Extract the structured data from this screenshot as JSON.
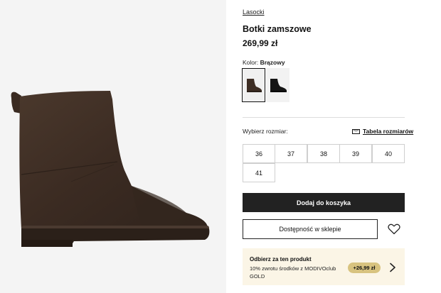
{
  "product": {
    "brand": "Lasocki",
    "name": "Botki zamszowe",
    "price": "269,99 zł"
  },
  "color": {
    "label": "Kolor:",
    "value": "Brązowy",
    "swatches": [
      {
        "name": "brown",
        "color": "#3a2a21",
        "selected": true
      },
      {
        "name": "black",
        "color": "#151515",
        "selected": false
      }
    ]
  },
  "sizes": {
    "label": "Wybierz rozmiar:",
    "table_link": "Tabela rozmiarów",
    "options": [
      "36",
      "37",
      "38",
      "39",
      "40",
      "41"
    ]
  },
  "actions": {
    "add_to_cart": "Dodaj do koszyka",
    "store_availability": "Dostępność w sklepie",
    "wishlist_icon": "heart-icon"
  },
  "promo": {
    "title": "Odbierz za ten produkt",
    "description": "10% zwrotu środków z MODIVOclub GOLD",
    "badge": "+26,99 zł"
  },
  "colors": {
    "primary_button": "#222222",
    "promo_bg": "#fbf5e6",
    "promo_badge": "#d8c37f",
    "product_main": "#3d2d23"
  }
}
